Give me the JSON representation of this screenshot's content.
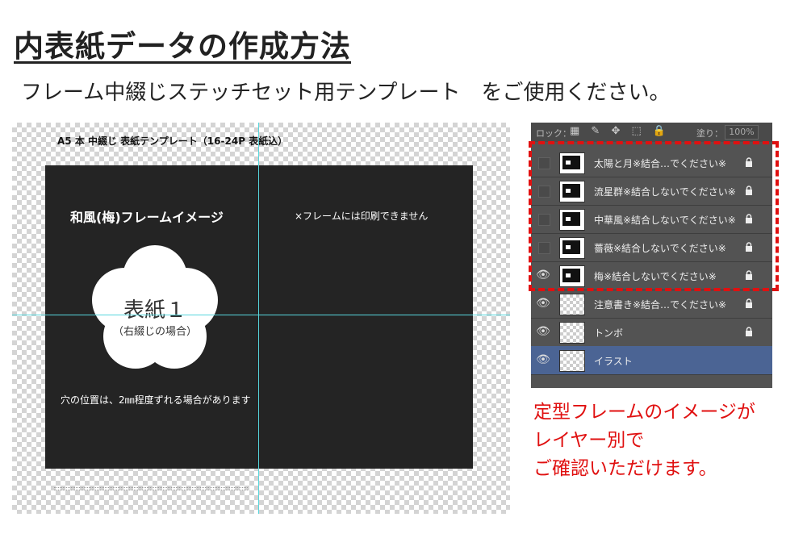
{
  "page": {
    "title": "内表紙データの作成方法",
    "subtitle": "フレーム中綴じステッチセット用テンプレート　をご使用ください。"
  },
  "template": {
    "label": "A5 本 中綴じ 表紙テンプレート（16-24P 表紙込）",
    "frame_name": "和風(梅)フレームイメージ",
    "frame_note": "×フレームには印刷できません",
    "cover_title": "表紙１",
    "cover_subtitle": "（右綴じの場合）",
    "hole_note": "穴の位置は、2㎜程度ずれる場合があります",
    "colors": {
      "cover": "#242424",
      "guide": "#56d6dc"
    }
  },
  "layers_panel": {
    "lock_label": "ロック：",
    "lock_icons": "▦ ✎ ✥ ⬚ 🔒",
    "fill_label": "塗り：",
    "fill_value": "100%",
    "layers": [
      {
        "name": "太陽と月※結合…でください※",
        "visible": false,
        "thumb": "dark",
        "locked": true
      },
      {
        "name": "流星群※結合しないでください※",
        "visible": false,
        "thumb": "dark",
        "locked": true
      },
      {
        "name": "中華風※結合しないでください※",
        "visible": false,
        "thumb": "dark",
        "locked": true
      },
      {
        "name": "薔薇※結合しないでください※",
        "visible": false,
        "thumb": "dark",
        "locked": true
      },
      {
        "name": "梅※結合しないでください※",
        "visible": true,
        "thumb": "dark",
        "locked": true
      },
      {
        "name": "注意書き※結合…でください※",
        "visible": true,
        "thumb": "checker",
        "locked": true
      },
      {
        "name": "トンボ",
        "visible": true,
        "thumb": "checker",
        "locked": true
      },
      {
        "name": "イラスト",
        "visible": true,
        "thumb": "checker",
        "locked": false,
        "selected": true
      }
    ]
  },
  "caption": {
    "line1": "定型フレームのイメージが",
    "line2": "レイヤー別で",
    "line3": "ご確認いただけます。",
    "color": "#e01010"
  }
}
